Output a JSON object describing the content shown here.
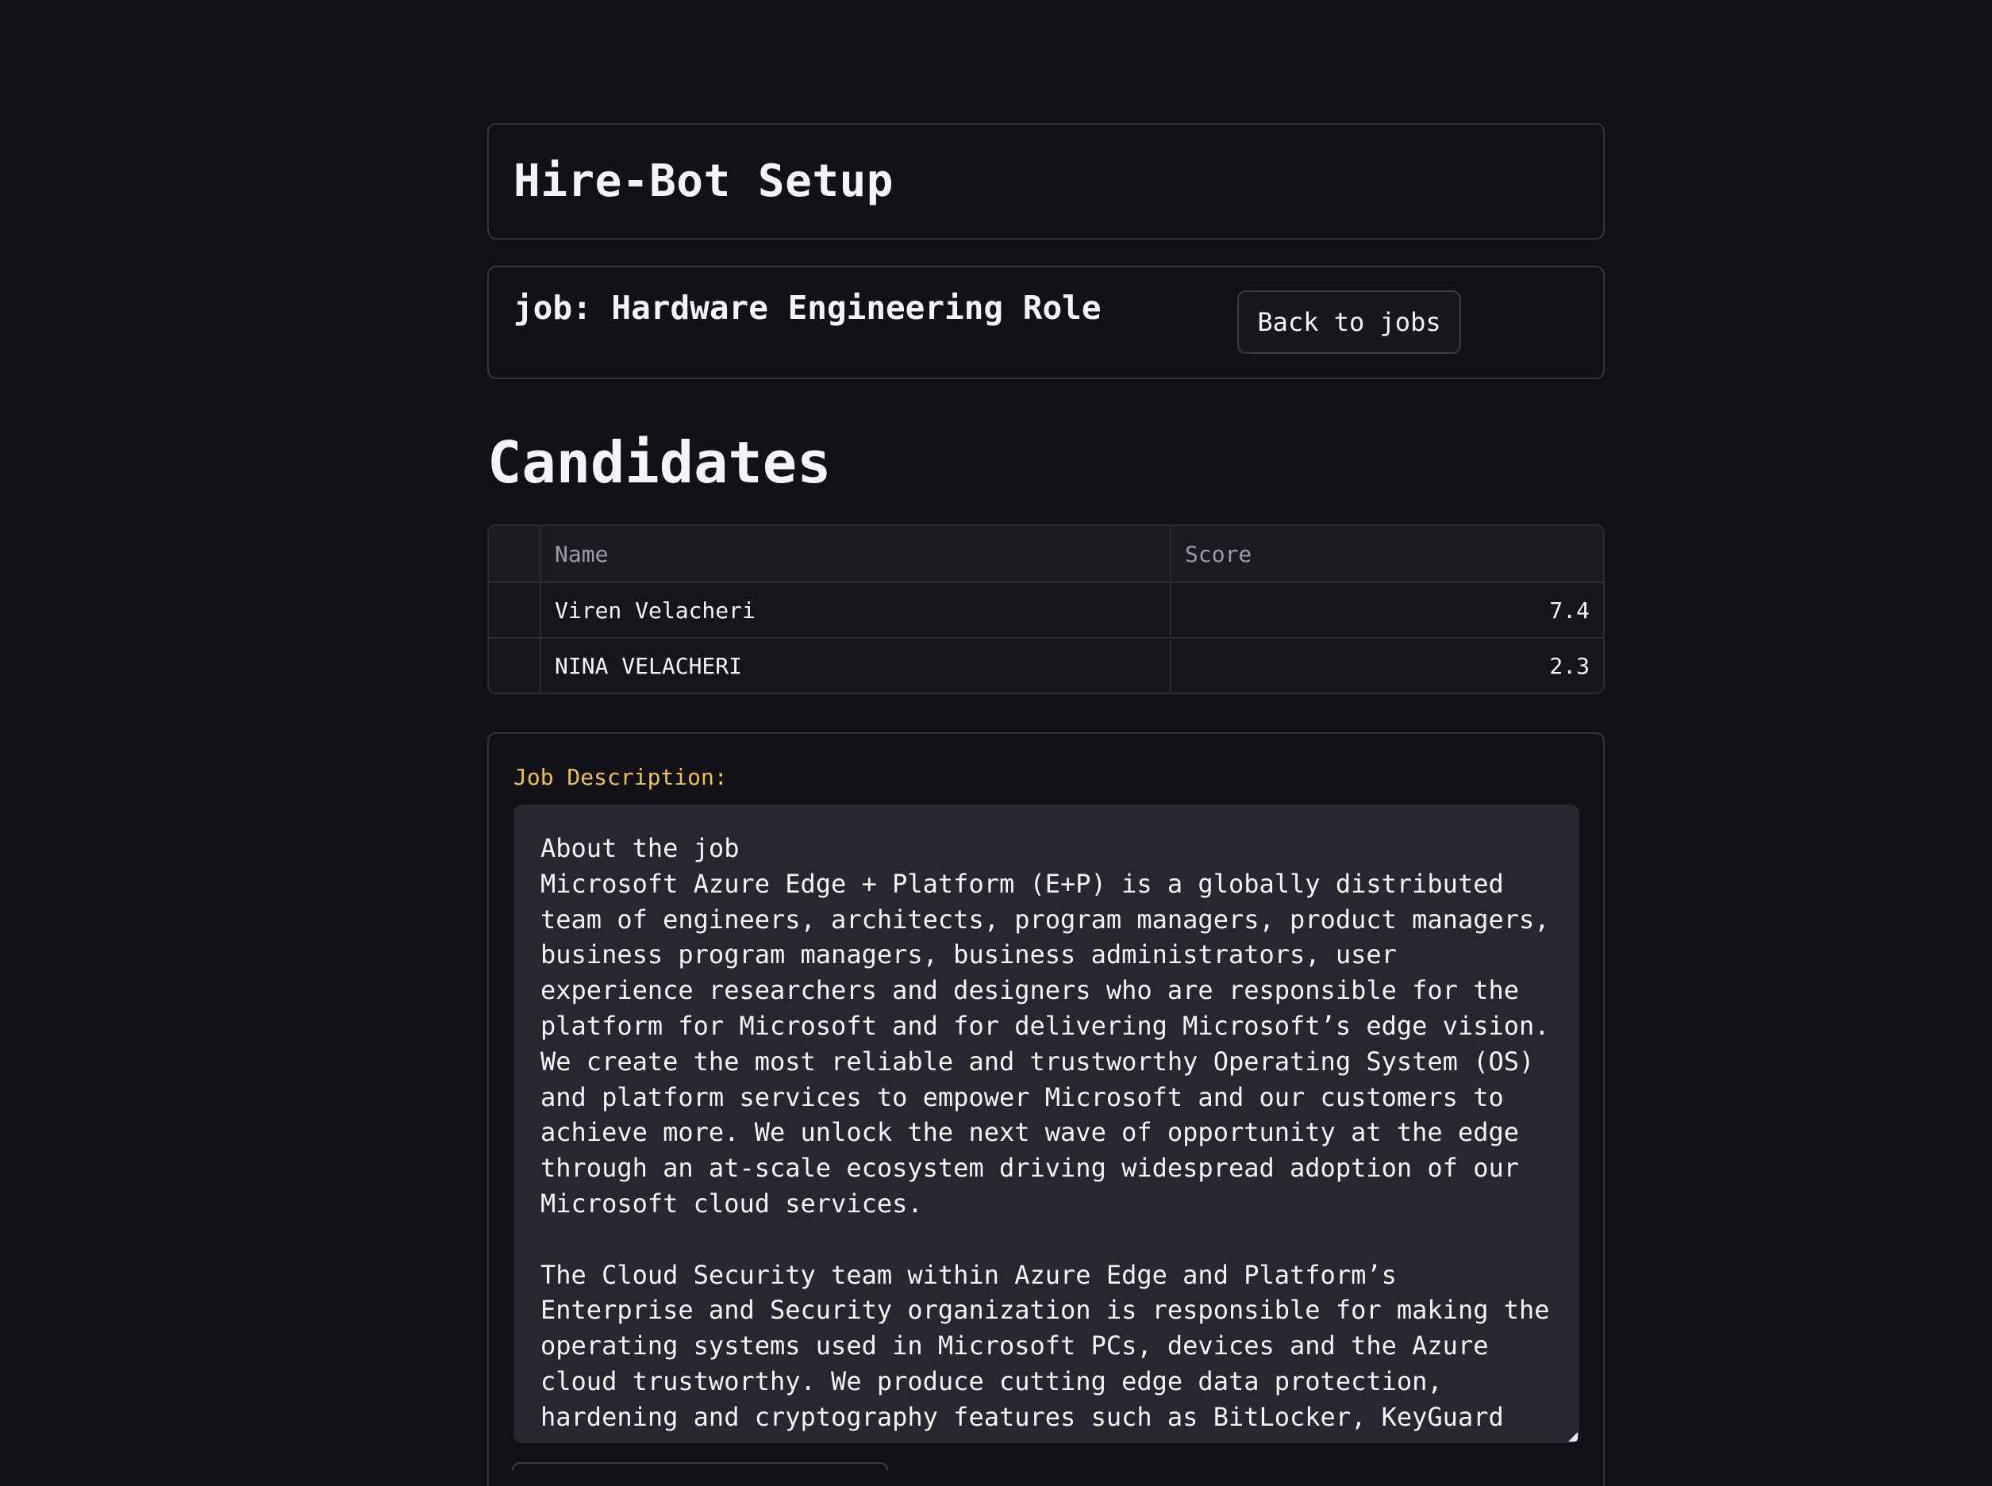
{
  "header": {
    "title": "Hire-Bot Setup"
  },
  "job": {
    "title": "job: Hardware Engineering Role",
    "back_button_label": "Back to jobs"
  },
  "candidates": {
    "heading": "Candidates",
    "columns": [
      "",
      "Name",
      "Score"
    ],
    "rows": [
      {
        "name": "Viren Velacheri",
        "score": "7.4"
      },
      {
        "name": "NINA VELACHERI",
        "score": "2.3"
      }
    ]
  },
  "description": {
    "label": "Job Description:",
    "text": "About the job\nMicrosoft Azure Edge + Platform (E+P) is a globally distributed team of engineers, architects, program managers, product managers, business program managers, business administrators, user experience researchers and designers who are responsible for the platform for Microsoft and for delivering Microsoft’s edge vision. We create the most reliable and trustworthy Operating System (OS) and platform services to empower Microsoft and our customers to achieve more. We unlock the next wave of opportunity at the edge through an at-scale ecosystem driving widespread adoption of our Microsoft cloud services.\n\nThe Cloud Security team within Azure Edge and Platform’s Enterprise and Security organization is responsible for making the operating systems used in Microsoft PCs, devices and the Azure cloud trustworthy. We produce cutting edge data protection, hardening and cryptography features such as BitLocker, KeyGuard"
  }
}
